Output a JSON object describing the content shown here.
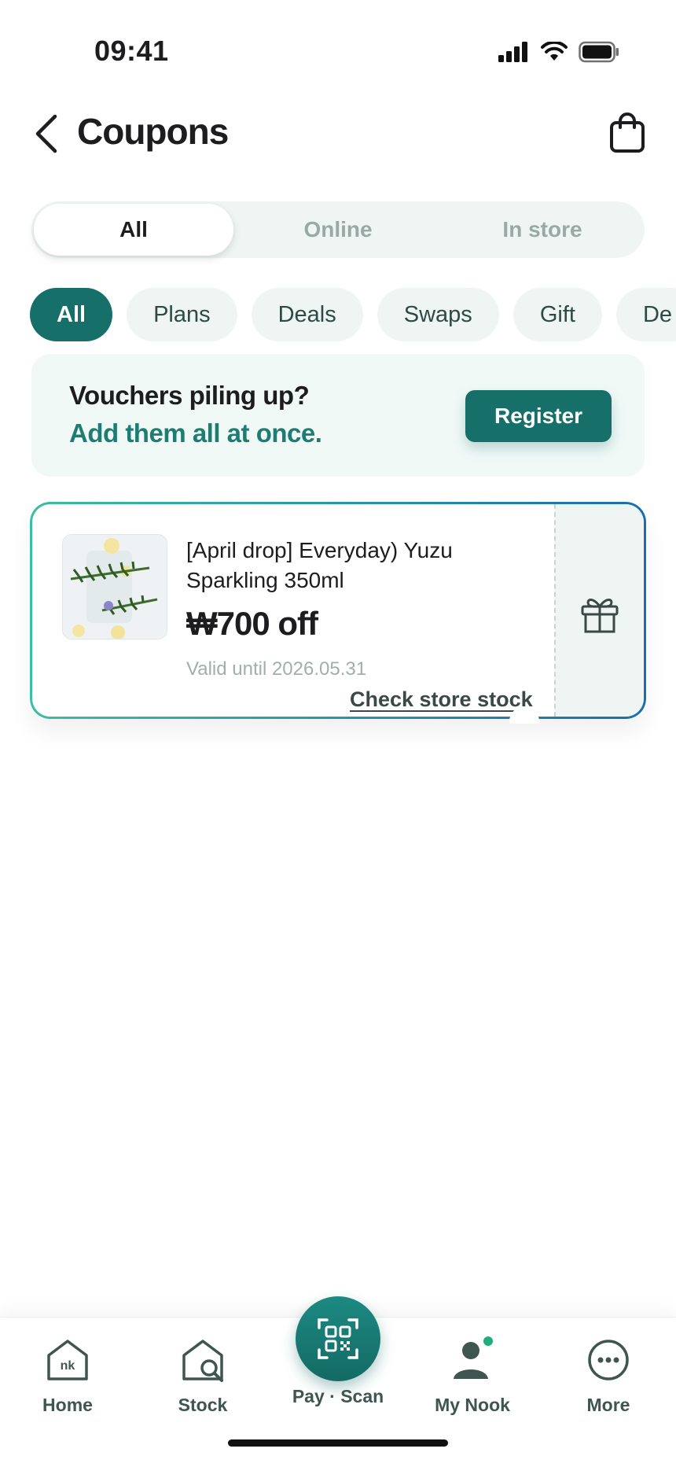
{
  "status_bar": {
    "time": "09:41"
  },
  "header": {
    "title": "Coupons"
  },
  "segments": [
    {
      "label": "All",
      "active": true
    },
    {
      "label": "Online",
      "active": false
    },
    {
      "label": "In store",
      "active": false
    }
  ],
  "chips": [
    {
      "label": "All",
      "active": true
    },
    {
      "label": "Plans",
      "active": false
    },
    {
      "label": "Deals",
      "active": false
    },
    {
      "label": "Swaps",
      "active": false
    },
    {
      "label": "Gift",
      "active": false
    },
    {
      "label": "De",
      "active": false
    }
  ],
  "banner": {
    "line1": "Vouchers piling up?",
    "line2": "Add them all at once.",
    "button": "Register"
  },
  "coupon": {
    "name": "[April drop] Everyday) Yuzu Sparkling 350ml",
    "amount": "₩700 off",
    "valid": "Valid until 2026.05.31",
    "link": "Check store stock"
  },
  "nav": {
    "home": "Home",
    "stock": "Stock",
    "pay": "Pay · Scan",
    "my": "My Nook",
    "more": "More",
    "home_logo": "nk"
  },
  "colors": {
    "brand": "#176f6a",
    "accent_text": "#1e7d72",
    "chip_bg": "#eef5f3",
    "badge": "#1fae7a"
  }
}
